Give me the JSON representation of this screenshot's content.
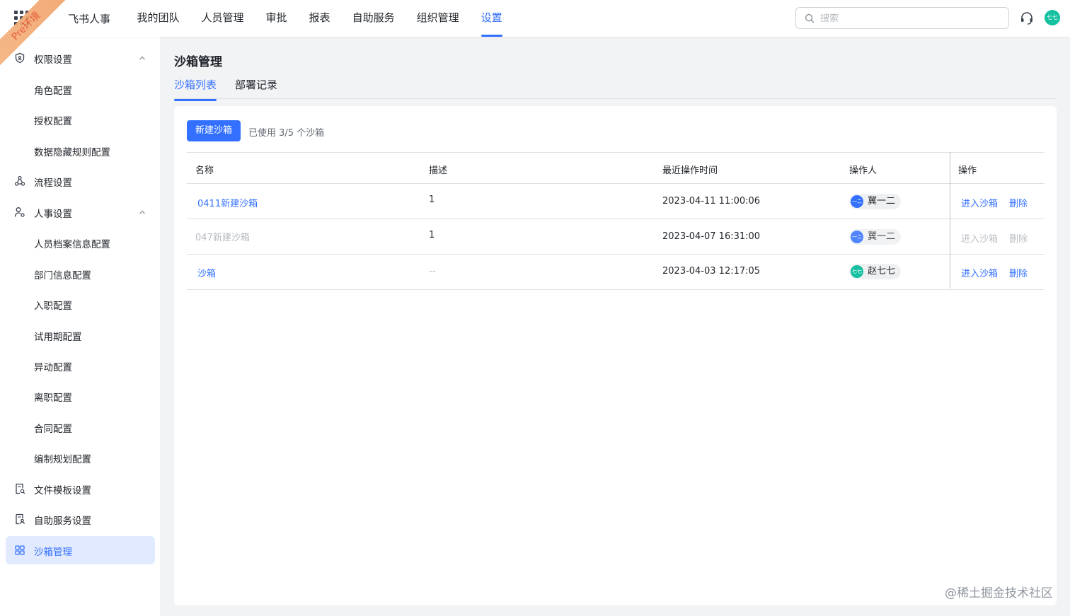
{
  "ribbon": {
    "text": "Pre环境"
  },
  "app": {
    "title": "飞书人事"
  },
  "topnav": {
    "items": [
      "我的团队",
      "人员管理",
      "审批",
      "报表",
      "自助服务",
      "组织管理",
      "设置"
    ],
    "active": "设置"
  },
  "search": {
    "placeholder": "搜索"
  },
  "user": {
    "avatar_text": "七七",
    "avatar_color": "#14c0a0"
  },
  "sidebar": {
    "items": [
      {
        "label": "权限设置",
        "icon": "shield-icon",
        "expandable": true
      },
      {
        "label": "角色配置"
      },
      {
        "label": "授权配置"
      },
      {
        "label": "数据隐藏规则配置"
      },
      {
        "label": "流程设置",
        "icon": "workflow-icon"
      },
      {
        "label": "人事设置",
        "icon": "user-settings-icon",
        "expandable": true
      },
      {
        "label": "人员档案信息配置"
      },
      {
        "label": "部门信息配置"
      },
      {
        "label": "入职配置"
      },
      {
        "label": "试用期配置"
      },
      {
        "label": "异动配置"
      },
      {
        "label": "离职配置"
      },
      {
        "label": "合同配置"
      },
      {
        "label": "编制规划配置"
      },
      {
        "label": "文件模板设置",
        "icon": "file-template-icon"
      },
      {
        "label": "自助服务设置",
        "icon": "self-service-icon"
      },
      {
        "label": "沙箱管理",
        "icon": "grid-icon",
        "active": true
      }
    ]
  },
  "page": {
    "title": "沙箱管理",
    "tabs": [
      "沙箱列表",
      "部署记录"
    ],
    "new_button": "新建沙箱",
    "usage": "已使用 3/5 个沙箱"
  },
  "table": {
    "headers": [
      "名称",
      "描述",
      "最近操作时间",
      "操作人",
      "操作"
    ],
    "rows": [
      {
        "name": "0411新建沙箱",
        "desc": "1",
        "time": "2023-04-11 11:00:06",
        "operator": "冀一二",
        "avatar": "一二",
        "avatar_color": "#3370ff",
        "enter": "进入沙箱",
        "delete": "删除",
        "enabled": true
      },
      {
        "name": "047新建沙箱",
        "desc": "1",
        "time": "2023-04-07 16:31:00",
        "operator": "冀一二",
        "avatar": "一二",
        "avatar_color": "#3370ff",
        "enter": "进入沙箱",
        "delete": "删除",
        "enabled": false
      },
      {
        "name": "沙箱",
        "desc": "--",
        "time": "2023-04-03 12:17:05",
        "operator": "赵七七",
        "avatar": "七七",
        "avatar_color": "#14c0a0",
        "enter": "进入沙箱",
        "delete": "删除",
        "enabled": true
      }
    ]
  },
  "watermark": "@稀土掘金技术社区",
  "colors": {
    "accent": "#3370ff",
    "sidebar_active_bg": "#e1eaff",
    "disabled": "#bbbfc4"
  }
}
